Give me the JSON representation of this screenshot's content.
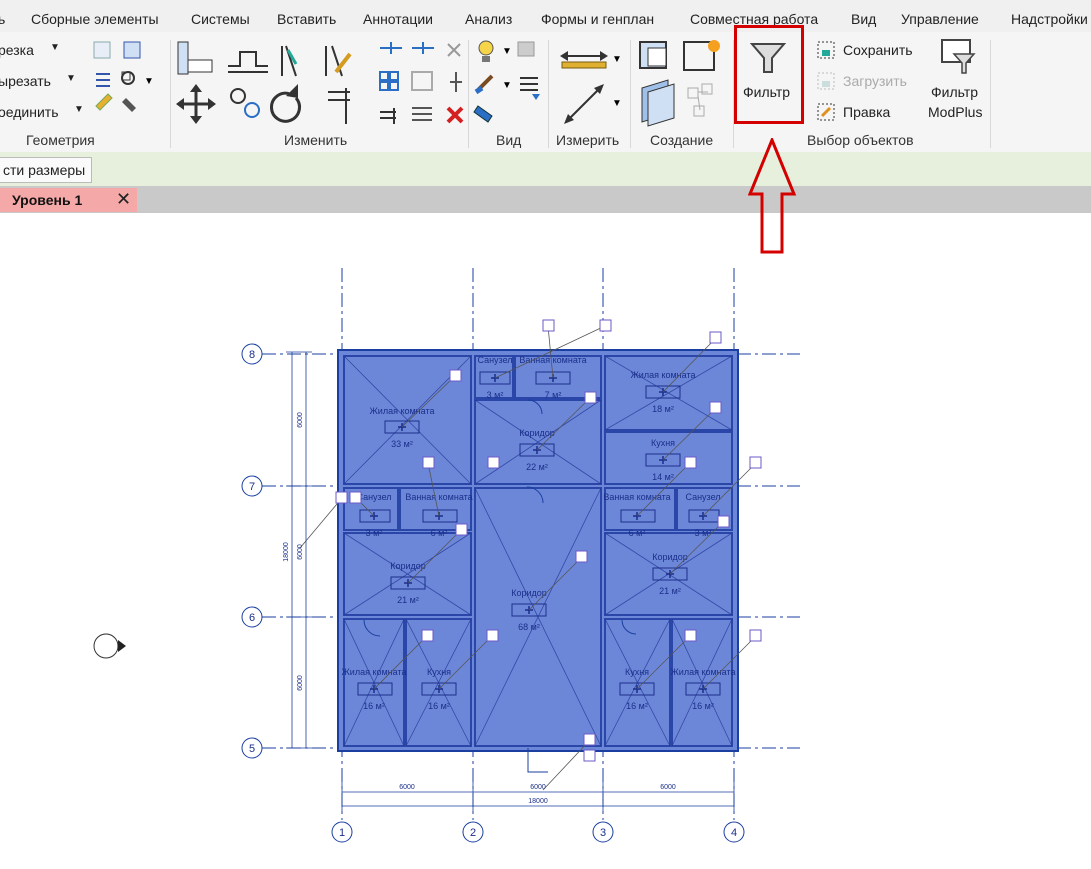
{
  "menu": {
    "items": [
      "ь",
      "Сборные элементы",
      "Системы",
      "Вставить",
      "Аннотации",
      "Анализ",
      "Формы и генплан",
      "Совместная работа",
      "Вид",
      "Управление",
      "Надстройки"
    ]
  },
  "ribbon": {
    "geometry": {
      "label": "Геометрия",
      "cut": "резка",
      "unjoin": "ырезать",
      "join": "оединить"
    },
    "modify": {
      "label": "Изменить"
    },
    "view": {
      "label": "Вид"
    },
    "measure": {
      "label": "Измерить"
    },
    "create": {
      "label": "Создание"
    },
    "select": {
      "label": "Выбор объектов",
      "filter": "Фильтр",
      "save": "Сохранить",
      "load": "Загрузить",
      "edit": "Правка",
      "modplus_line1": "Фильтр",
      "modplus_line2": "ModPlus"
    }
  },
  "options_bar": {
    "dimensions_button": "сти размеры"
  },
  "doc_tab": {
    "title": "Уровень 1",
    "close": "✕"
  },
  "plan": {
    "grid_bubbles_h": [
      "8",
      "7",
      "6",
      "5"
    ],
    "grid_bubbles_v": [
      "1",
      "2",
      "3",
      "4"
    ],
    "rooms": [
      {
        "name": "Санузел",
        "area": "3 м²"
      },
      {
        "name": "Ванная комната",
        "area": "7 м²"
      },
      {
        "name": "Жилая комната",
        "area": "18 м²"
      },
      {
        "name": "Жилая комната",
        "area": "33 м²"
      },
      {
        "name": "Коридор",
        "area": "22 м²"
      },
      {
        "name": "Кухня",
        "area": "14 м²"
      },
      {
        "name": "Санузел",
        "area": "3 м²"
      },
      {
        "name": "Ванная комната",
        "area": "6 м²"
      },
      {
        "name": "Ванная комната",
        "area": "6 м²"
      },
      {
        "name": "Санузел",
        "area": "3 м²"
      },
      {
        "name": "Коридор",
        "area": "21 м²"
      },
      {
        "name": "Коридор",
        "area": "68 м²"
      },
      {
        "name": "Коридор",
        "area": "21 м²"
      },
      {
        "name": "Жилая комната",
        "area": "16 м²"
      },
      {
        "name": "Кухня",
        "area": "16 м²"
      },
      {
        "name": "Кухня",
        "area": "16 м²"
      },
      {
        "name": "Жилая комната",
        "area": "16 м²"
      }
    ],
    "dims": {
      "seg": "6000",
      "total": "18000"
    }
  },
  "colors": {
    "accent_red": "#d40000",
    "room_fill": "#6d87d8",
    "grid_blue": "#1a3fa0"
  }
}
